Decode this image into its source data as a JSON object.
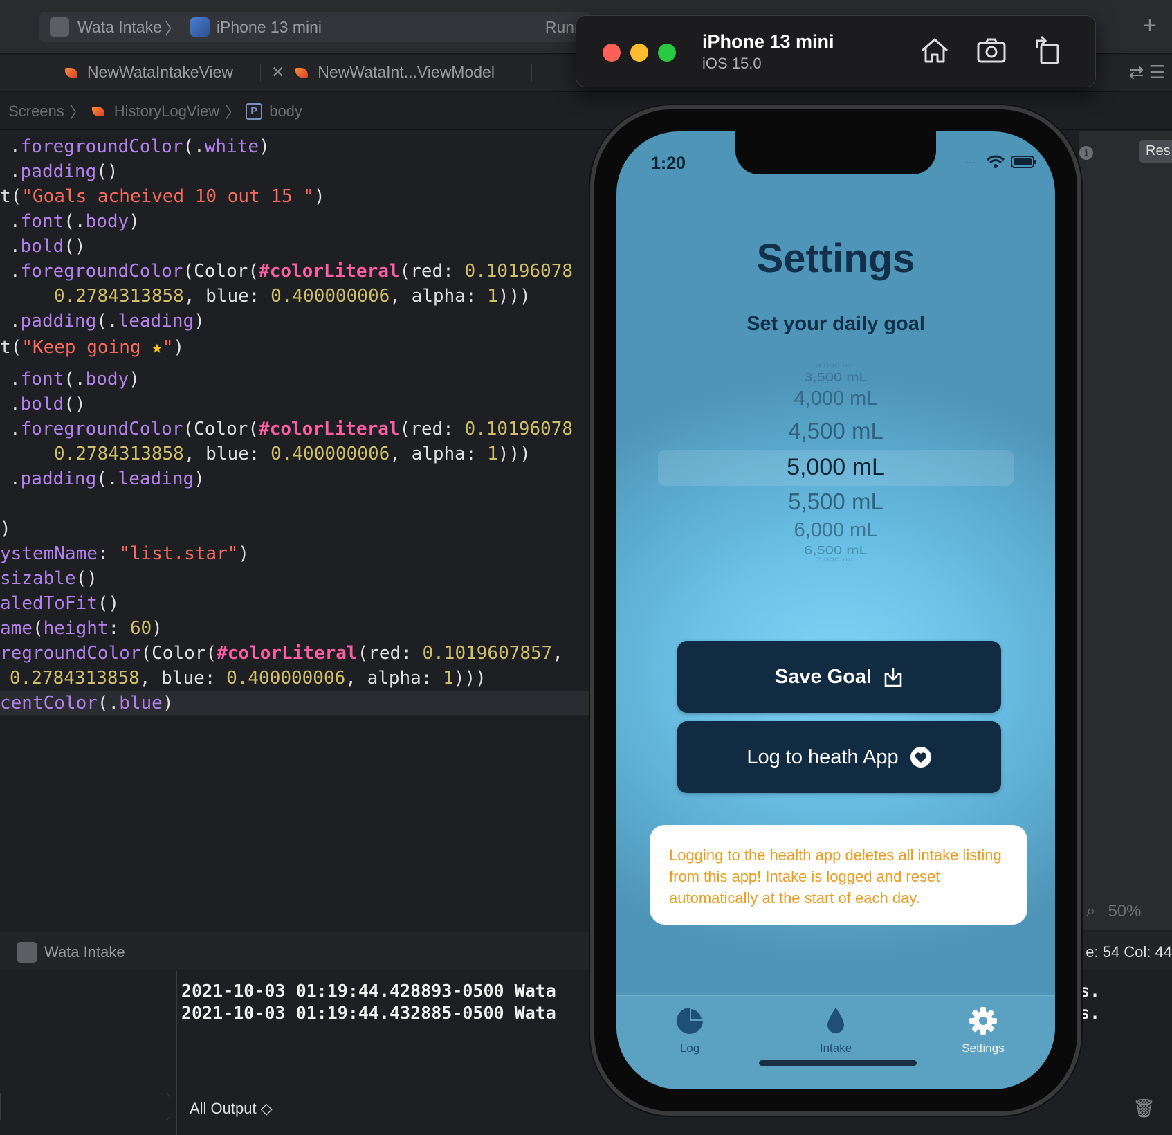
{
  "toolbar": {
    "app_name": "Wata Intake",
    "device": "iPhone 13 mini",
    "status": "Runni",
    "plus_icon": "+"
  },
  "tabs": [
    {
      "label": "NewWataIntakeView"
    },
    {
      "label": "NewWataInt...ViewModel"
    }
  ],
  "jumpbar": {
    "items": [
      "Screens",
      "HistoryLogView",
      "body"
    ],
    "p_badge": "P"
  },
  "code_lines": [
    {
      "t": ".foregroundColor(.white)"
    },
    {
      "t": ".padding()"
    },
    {
      "t": "t(\"Goals acheived 10 out 15 \")"
    },
    {
      "t": ".font(.body)"
    },
    {
      "t": ".bold()"
    },
    {
      "t": ".foregroundColor(Color(#colorLiteral(red: 0.10196078"
    },
    {
      "t": "0.2784313858, blue: 0.400000006, alpha: 1)))"
    },
    {
      "t": ".padding(.leading)"
    },
    {
      "t": "t(\"Keep going ⭐\")"
    },
    {
      "t": ".font(.body)"
    },
    {
      "t": ".bold()"
    },
    {
      "t": ".foregroundColor(Color(#colorLiteral(red: 0.10196078"
    },
    {
      "t": "0.2784313858, blue: 0.400000006, alpha: 1)))"
    },
    {
      "t": ".padding(.leading)"
    },
    {
      "t": ")"
    },
    {
      "t": "ystemName: \"list.star\")"
    },
    {
      "t": "sizable()"
    },
    {
      "t": "aledToFit()"
    },
    {
      "t": "ame(height: 60)"
    },
    {
      "t": "regroundColor(Color(#colorLiteral(red: 0.1019607857,"
    },
    {
      "t": "0.2784313858, blue: 0.400000006, alpha: 1)))"
    },
    {
      "t": "centColor(.blue)"
    }
  ],
  "right_pane": {
    "res_label": "Res",
    "zoom": "50%"
  },
  "debug": {
    "target": "Wata Intake",
    "line_col": "e: 54  Col: 44",
    "log_lines": [
      "2021-10-03 01:19:44.428893-0500 Wata",
      "2021-10-03 01:19:44.432885-0500 Wata"
    ],
    "log_suffix": [
      "s.",
      "s."
    ],
    "output_select": "All Output ◇"
  },
  "simulator": {
    "title": "iPhone 13 mini",
    "subtitle": "iOS 15.0",
    "traffic_colors": [
      "#fe5f57",
      "#febc2e",
      "#28c840"
    ],
    "buttons": [
      "home-icon",
      "screenshot-icon",
      "rotate-icon"
    ]
  },
  "app": {
    "time": "1:20",
    "title": "Settings",
    "goal_label": "Set your daily goal",
    "picker": {
      "values": [
        "3,000 mL",
        "3,500 mL",
        "4,000 mL",
        "4,500 mL",
        "5,000 mL",
        "5,500 mL",
        "6,000 mL",
        "6,500 mL",
        "7,000 mL"
      ],
      "selected": "5,000 mL"
    },
    "save_button": "Save Goal",
    "log_button": "Log to heath App",
    "note": "Logging to the health app deletes all intake listing from this app! Intake is logged and reset automatically at the start of each day.",
    "tabs": [
      {
        "label": "Log",
        "icon": "chart-pie-icon"
      },
      {
        "label": "Intake",
        "icon": "drop-icon"
      },
      {
        "label": "Settings",
        "icon": "gear-icon"
      }
    ],
    "accent": "#112b42",
    "note_color": "#ee9a1b"
  }
}
